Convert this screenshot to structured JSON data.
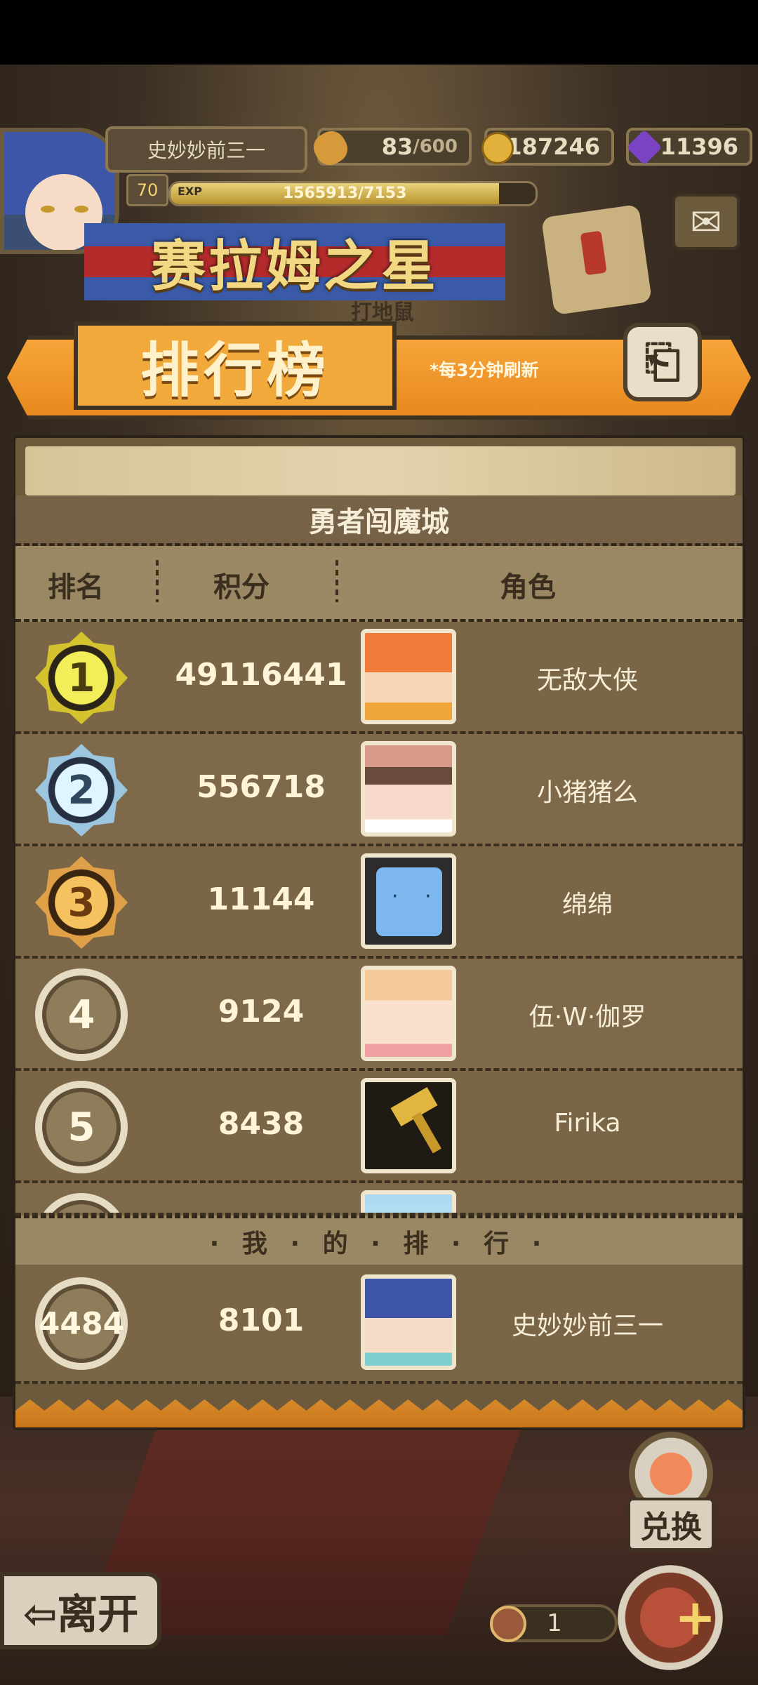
{
  "player": {
    "name": "史妙妙前三一",
    "level": "70",
    "exp_label": "EXP",
    "exp_text": "1565913/7153",
    "exp_fraction": 0.9
  },
  "resources": {
    "stamina_current": "83",
    "stamina_max": "/600",
    "gold": "187246",
    "gems": "11396"
  },
  "event": {
    "title": "赛拉姆之星",
    "subtitle": "打地鼠"
  },
  "ribbon": {
    "title": "排行榜",
    "note": "*每3分钟刷新",
    "back_icon": "⎗"
  },
  "panel": {
    "title": "勇者闯魔城",
    "columns": [
      "排名",
      "积分",
      "角色"
    ]
  },
  "leaderboard": [
    {
      "rank": "1",
      "score": "49116441",
      "name": "无敌大侠"
    },
    {
      "rank": "2",
      "score": "556718",
      "name": "小猪猪么"
    },
    {
      "rank": "3",
      "score": "11144",
      "name": "绵绵"
    },
    {
      "rank": "4",
      "score": "9124",
      "name": "伍·W·伽罗"
    },
    {
      "rank": "5",
      "score": "8438",
      "name": "Firika"
    }
  ],
  "my_rank": {
    "header": "· 我 · 的 · 排 · 行 ·",
    "rank": "4484",
    "score": "8101",
    "name": "史妙妙前三一"
  },
  "bottom": {
    "exchange_label": "兑换",
    "leave_label": "⇦离开",
    "coin_count": "1",
    "add_symbol": "+"
  },
  "icons": {
    "mail": "✉"
  }
}
